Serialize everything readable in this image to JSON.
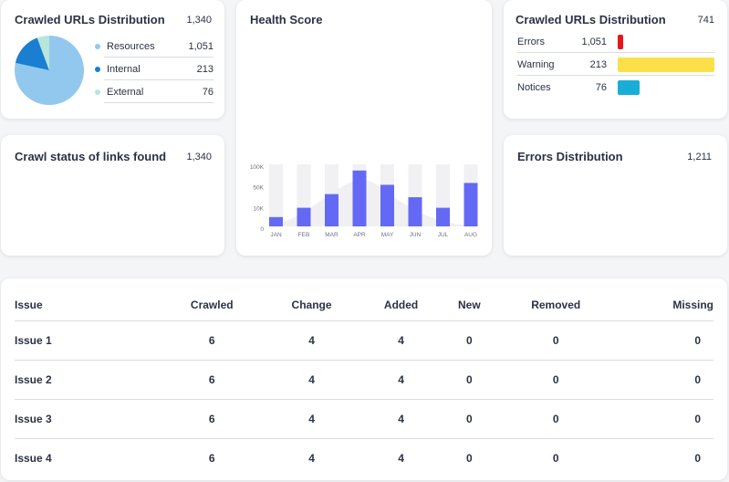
{
  "cards": {
    "crawled_urls_1": {
      "title": "Crawled URLs Distribution",
      "count": "1,340",
      "legend": [
        {
          "label": "Resources",
          "value": "1,051",
          "color": "#93c8ee"
        },
        {
          "label": "Internal",
          "value": "213",
          "color": "#1a7fd1"
        },
        {
          "label": "External",
          "value": "76",
          "color": "#b7e6da"
        }
      ]
    },
    "health_score": {
      "title": "Health Score"
    },
    "crawled_urls_2": {
      "title": "Crawled URLs Distribution",
      "count": "741",
      "rows": [
        {
          "label": "Errors",
          "value": "1,051",
          "color": "#e8161b",
          "fill": 0.06
        },
        {
          "label": "Warning",
          "value": "213",
          "color": "#fbe04a",
          "fill": 1.0
        },
        {
          "label": "Notices",
          "value": "76",
          "color": "#1aaed6",
          "fill": 0.23
        }
      ]
    },
    "crawl_status": {
      "title": "Crawl status of links found",
      "count": "1,340"
    },
    "errors_distribution": {
      "title": "Errors Distribution",
      "count": "1,211"
    }
  },
  "chart_data": [
    {
      "type": "pie",
      "categories": [
        "Resources",
        "Internal",
        "External"
      ],
      "values": [
        1051,
        213,
        76
      ],
      "colors": [
        "#93c8ee",
        "#1a7fd1",
        "#b7e6da"
      ]
    },
    {
      "type": "bar",
      "categories": [
        "JAN",
        "FEB",
        "MAR",
        "APR",
        "MAY",
        "JUN",
        "JUL",
        "AUG"
      ],
      "values": [
        15,
        30,
        52,
        90,
        67,
        47,
        30,
        70
      ],
      "yticks": [
        "100K",
        "50K",
        "10K",
        "0"
      ],
      "bar_color": "#6469f5",
      "track_color": "#efeff1"
    }
  ],
  "table": {
    "headers": [
      "Issue",
      "Crawled",
      "Change",
      "Added",
      "New",
      "Removed",
      "Missing"
    ],
    "rows": [
      [
        "Issue 1",
        "6",
        "4",
        "4",
        "0",
        "0",
        "0"
      ],
      [
        "Issue 2",
        "6",
        "4",
        "4",
        "0",
        "0",
        "0"
      ],
      [
        "Issue 3",
        "6",
        "4",
        "4",
        "0",
        "0",
        "0"
      ],
      [
        "Issue 4",
        "6",
        "4",
        "4",
        "0",
        "0",
        "0"
      ]
    ]
  }
}
